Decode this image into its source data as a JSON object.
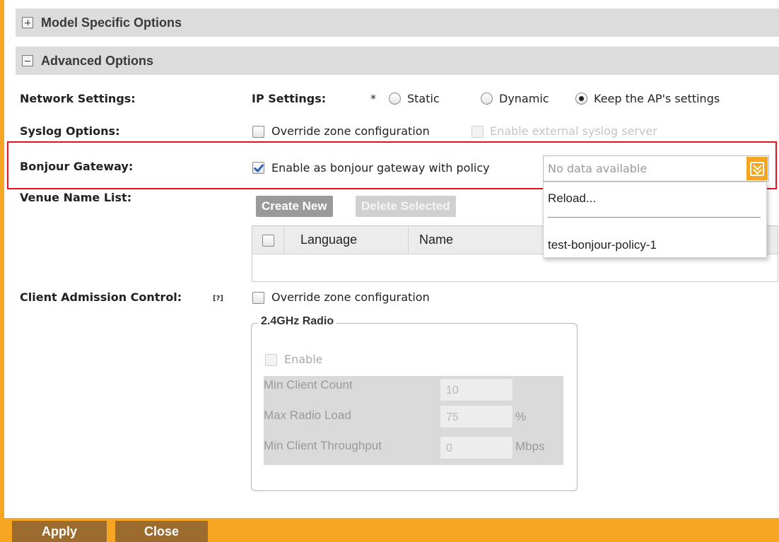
{
  "sections": {
    "model_specific": "Model Specific Options",
    "advanced": "Advanced Options"
  },
  "network": {
    "label": "Network Settings:",
    "ip_label": "IP Settings:",
    "required_mark": "*",
    "options": [
      "Static",
      "Dynamic",
      "Keep the AP's settings"
    ],
    "selected": "Keep the AP's settings"
  },
  "syslog": {
    "label": "Syslog Options:",
    "override": "Override zone configuration",
    "enable_external": "Enable external syslog server"
  },
  "bonjour": {
    "label": "Bonjour Gateway:",
    "enable": "Enable as bonjour gateway with policy",
    "enabled": true,
    "placeholder": "No data available",
    "dropdown_items": [
      "Reload...",
      "test-bonjour-policy-1"
    ]
  },
  "venue": {
    "label": "Venue Name List:",
    "create_new": "Create New",
    "delete_selected": "Delete Selected",
    "columns": [
      "Language",
      "Name"
    ]
  },
  "client_admission": {
    "label": "Client Admission Control:",
    "help": "[?]",
    "override": "Override zone configuration",
    "radio_title": "2.4GHz Radio",
    "enable": "Enable",
    "fields": [
      {
        "label": "Min Client Count",
        "value": "10",
        "unit": ""
      },
      {
        "label": "Max Radio Load",
        "value": "75",
        "unit": "%"
      },
      {
        "label": "Min Client Throughput",
        "value": "0",
        "unit": "Mbps"
      }
    ]
  },
  "footer": {
    "apply": "Apply",
    "close": "Close"
  },
  "colors": {
    "accent": "#f6a623",
    "highlight": "#e8131d",
    "footer_button": "#9c6b2e"
  }
}
